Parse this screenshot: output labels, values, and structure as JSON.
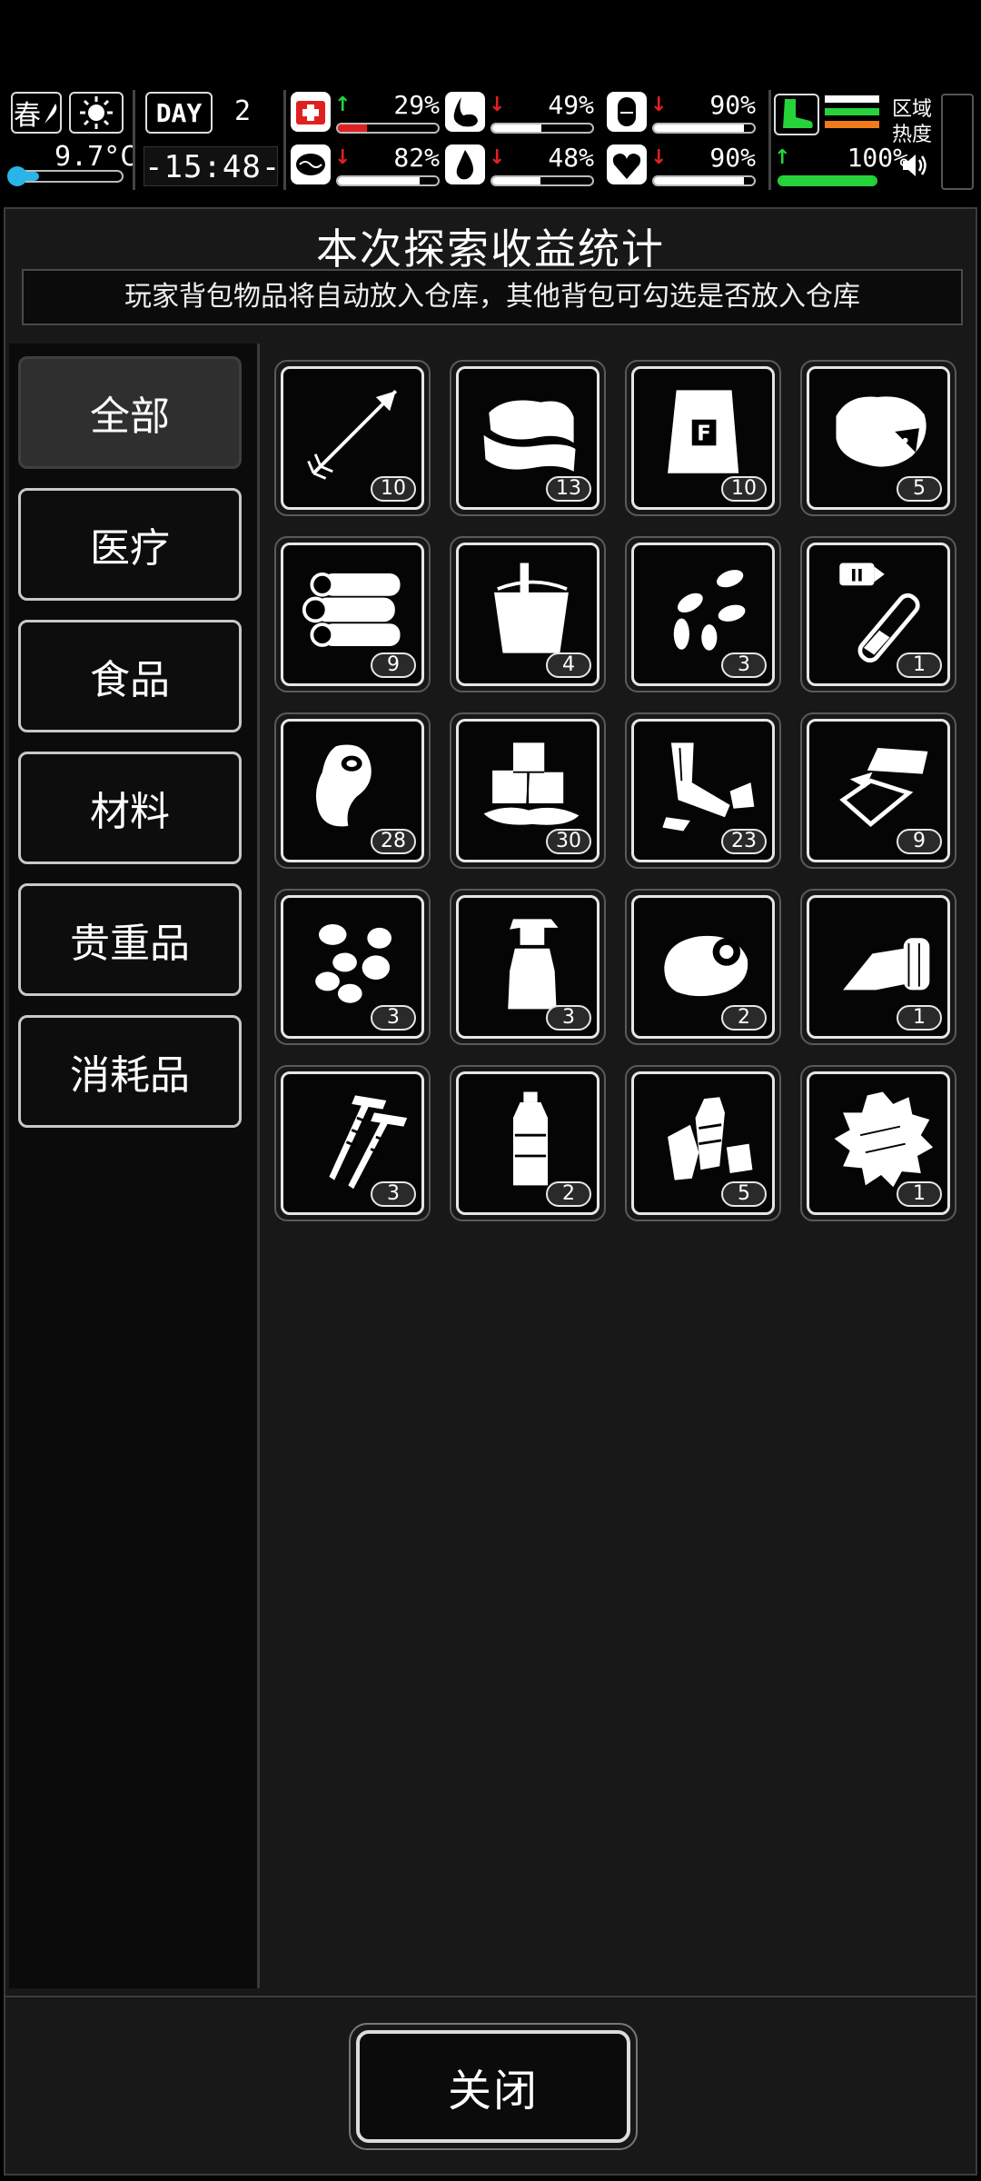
{
  "hud": {
    "season": "春",
    "temperature": "9.7°C",
    "temperature_level": 0.25,
    "day_label": "DAY",
    "day_number": "2",
    "time": "-15:48-",
    "stats": [
      {
        "name": "health",
        "icon": "medkit-icon",
        "trend": "up",
        "value": "29%",
        "level": 0.29,
        "color": "#e02020"
      },
      {
        "name": "hunger",
        "icon": "stomach-icon",
        "trend": "down",
        "value": "49%",
        "level": 0.49,
        "color": "#ffffff"
      },
      {
        "name": "fatigue",
        "icon": "pill-icon",
        "trend": "down",
        "value": "90%",
        "level": 0.9,
        "color": "#ffffff"
      },
      {
        "name": "sanity",
        "icon": "brain-icon",
        "trend": "down",
        "value": "82%",
        "level": 0.82,
        "color": "#ffffff"
      },
      {
        "name": "thirst",
        "icon": "water-drop-icon",
        "trend": "down",
        "value": "48%",
        "level": 0.48,
        "color": "#ffffff"
      },
      {
        "name": "mood",
        "icon": "heart-icon",
        "trend": "down",
        "value": "90%",
        "level": 0.9,
        "color": "#ffffff"
      }
    ],
    "stamina": {
      "value": "100%",
      "level": 1.0,
      "color": "#27d33a"
    },
    "region_label_1": "区域",
    "region_label_2": "热度"
  },
  "panel": {
    "title": "本次探索收益统计",
    "subtitle": "玩家背包物品将自动放入仓库，其他背包可勾选是否放入仓库"
  },
  "categories": [
    {
      "label": "全部",
      "active": true
    },
    {
      "label": "医疗",
      "active": false
    },
    {
      "label": "食品",
      "active": false
    },
    {
      "label": "材料",
      "active": false
    },
    {
      "label": "贵重品",
      "active": false
    },
    {
      "label": "消耗品",
      "active": false
    }
  ],
  "items": [
    {
      "icon": "arrow-icon",
      "count": "10"
    },
    {
      "icon": "cloth-icon",
      "count": "13"
    },
    {
      "icon": "flour-bag-icon",
      "count": "10"
    },
    {
      "icon": "rock-icon",
      "count": "5"
    },
    {
      "icon": "logs-icon",
      "count": "9"
    },
    {
      "icon": "bucket-icon",
      "count": "4"
    },
    {
      "icon": "seeds-icon",
      "count": "3"
    },
    {
      "icon": "test-tube-icon",
      "count": "1"
    },
    {
      "icon": "meat-icon",
      "count": "28"
    },
    {
      "icon": "ice-icon",
      "count": "30"
    },
    {
      "icon": "scrap-metal-icon",
      "count": "23"
    },
    {
      "icon": "glass-shards-icon",
      "count": "9"
    },
    {
      "icon": "potatoes-icon",
      "count": "3"
    },
    {
      "icon": "spray-bottle-icon",
      "count": "3"
    },
    {
      "icon": "tape-roll-icon",
      "count": "2"
    },
    {
      "icon": "bandage-icon",
      "count": "1"
    },
    {
      "icon": "screws-icon",
      "count": "3"
    },
    {
      "icon": "water-bottle-icon",
      "count": "2"
    },
    {
      "icon": "plastic-bottles-icon",
      "count": "5"
    },
    {
      "icon": "cotton-icon",
      "count": "1"
    }
  ],
  "footer": {
    "close_label": "关闭"
  }
}
